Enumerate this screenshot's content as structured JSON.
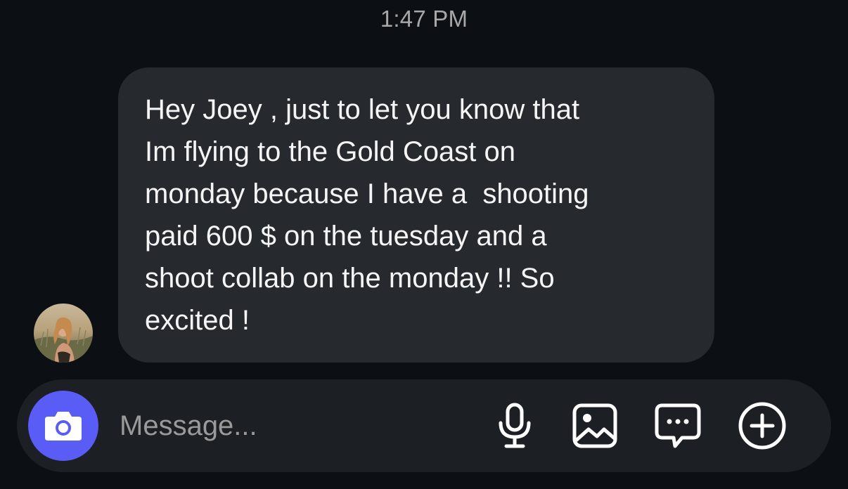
{
  "thread": {
    "timestamp": "1:47 PM"
  },
  "message": {
    "sender_avatar": "avatar",
    "text": "Hey Joey , just to let you know that\nIm flying to the Gold Coast on\nmonday because I have a  shooting\npaid 600 $ on the tuesday and a\nshoot collab on the monday !! So\nexcited !"
  },
  "composer": {
    "placeholder": "Message...",
    "value": "",
    "icons": [
      "camera-icon",
      "microphone-icon",
      "gallery-icon",
      "sticker-chat-icon",
      "plus-icon"
    ]
  },
  "colors": {
    "background": "#0c1014",
    "bubble": "#262a2f",
    "composer": "#1c1f23",
    "camera_button": "#5a5cf6",
    "timestamp_text": "#a8a8a8",
    "placeholder_text": "#9a9a9a"
  }
}
